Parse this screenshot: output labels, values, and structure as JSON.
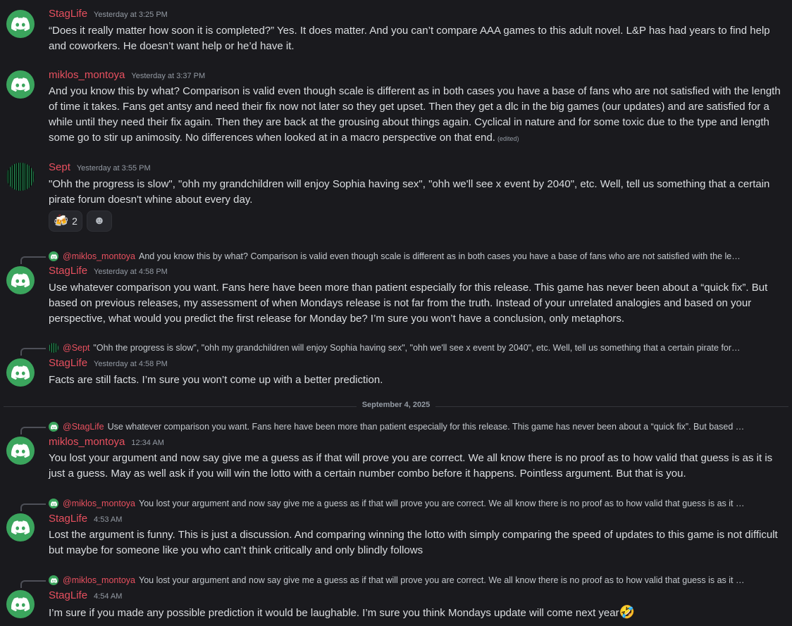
{
  "messages": [
    {
      "user": "StagLife",
      "time": "Yesterday at 3:25 PM",
      "text": "“Does it really matter how soon it is completed?” Yes. It does matter. And you can’t compare AAA games to this adult novel. L&P has had years to find help and coworkers. He doesn’t want help or he’d have it."
    },
    {
      "user": "miklos_montoya",
      "time": "Yesterday at 3:37 PM",
      "text": "And you know this by what? Comparison is valid even though scale is different as in both cases you have a base of fans who are not satisfied with the length of time it takes. Fans get antsy and need their fix now not later so they get upset. Then they get a dlc in the big games (our updates) and are satisfied for a while until they need their fix again.  Then they are back at the grousing about things again. Cyclical in nature and for some toxic due to the type and length some go to stir up animosity.  No differences when looked at in a macro perspective on that end.",
      "edited": "(edited)"
    },
    {
      "user": "Sept",
      "time": "Yesterday at 3:55 PM",
      "text": "\"Ohh the progress is slow\", \"ohh my grandchildren will enjoy Sophia having sex\", \"ohh we'll see x event by 2040\", etc. Well, tell us something that a certain pirate forum doesn't whine about every day.",
      "reactions": [
        {
          "icon": "beer-mugs-emoji",
          "glyph": "🍻",
          "count": "2"
        },
        {
          "icon": "add-reaction-icon",
          "glyph": "☻",
          "count": ""
        }
      ]
    },
    {
      "reply_mention": "@miklos_montoya",
      "reply_text": "And you know this by what? Comparison is valid even though scale is different as in both cases you have a base of fans who are not satisfied with the le…",
      "user": "StagLife",
      "time": "Yesterday at 4:58 PM",
      "text": "Use whatever comparison you want. Fans here have been more than patient especially for this release. This game has never been about a “quick fix”. But based on previous releases, my assessment of when Mondays release is not far from the truth. Instead of your unrelated analogies and based on your perspective, what would you predict the first release for Monday be? I’m sure you won’t have a conclusion, only metaphors."
    },
    {
      "reply_mention": "@Sept",
      "reply_text": "\"Ohh the progress is slow\", \"ohh my grandchildren will enjoy Sophia having sex\", \"ohh we'll see x event by 2040\", etc. Well, tell us something that a certain pirate for…",
      "user": "StagLife",
      "time": "Yesterday at 4:58 PM",
      "text": "Facts are still facts. I’m sure you won’t come up with a better prediction."
    },
    {
      "reply_mention": "@StagLife",
      "reply_text": "Use whatever comparison you want. Fans here have been more than patient especially for this release. This game has never been about a “quick fix”. But based …",
      "user": "miklos_montoya",
      "time": "12:34 AM",
      "text": "You lost your argument and now say give me a guess as if that will prove you are correct. We all know there is no proof as to how valid that guess is as it is just a guess. May as well ask if you will win the lotto with a certain number combo before it happens. Pointless argument. But that is  you."
    },
    {
      "reply_mention": "@miklos_montoya",
      "reply_text": "You lost your argument and now say give me a guess as if that will prove you are correct. We all know there is no proof as to how valid that guess is as it …",
      "user": "StagLife",
      "time": "4:53 AM",
      "text": "Lost the argument is funny. This is just a discussion. And comparing winning the lotto with simply comparing the speed of updates to this game is not difficult but maybe for someone like you who can’t think critically and only blindly follows"
    },
    {
      "reply_mention": "@miklos_montoya",
      "reply_text": "You lost your argument and now say give me a guess as if that will prove you are correct. We all know there is no proof as to how valid that guess is as it …",
      "user": "StagLife",
      "time": "4:54 AM",
      "text": "I’m sure if you made any possible prediction it would be laughable. I’m sure you think Mondays update will come next year",
      "emoji": "🤣"
    }
  ],
  "divider": "September 4, 2025",
  "colors": {
    "username": "#e8505f",
    "background": "#1a1a1e",
    "avatar": "#3ba55d"
  }
}
